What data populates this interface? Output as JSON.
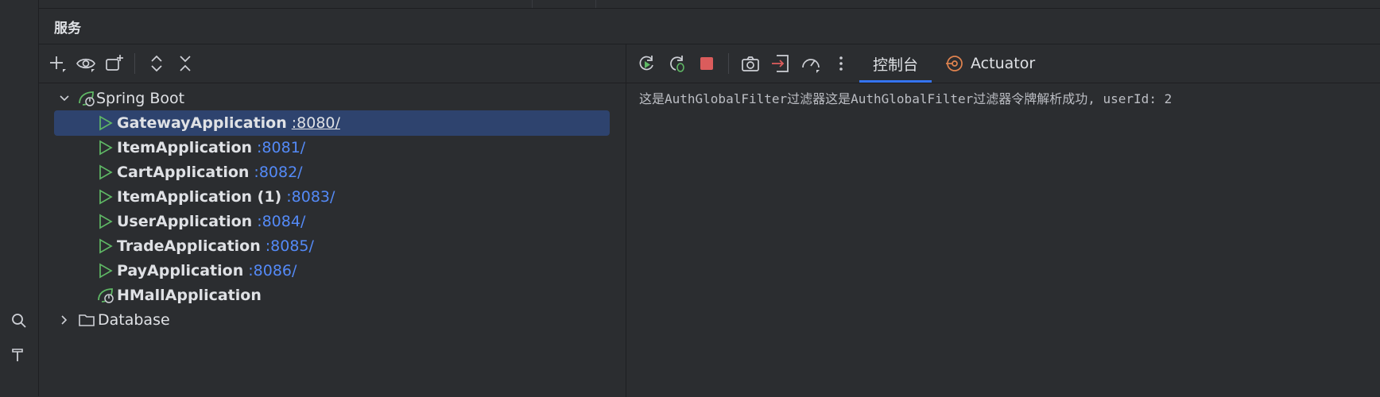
{
  "panel": {
    "title": "服务"
  },
  "tree": {
    "group": {
      "label": "Spring Boot"
    },
    "apps": [
      {
        "name": "GatewayApplication",
        "port": ":8080/"
      },
      {
        "name": "ItemApplication",
        "port": ":8081/"
      },
      {
        "name": "CartApplication",
        "port": ":8082/"
      },
      {
        "name": "ItemApplication (1)",
        "port": ":8083/"
      },
      {
        "name": "UserApplication",
        "port": ":8084/"
      },
      {
        "name": "TradeApplication",
        "port": ":8085/"
      },
      {
        "name": "PayApplication",
        "port": ":8086/"
      }
    ],
    "stopped_app": {
      "name": "HMallApplication"
    },
    "database": {
      "label": "Database"
    }
  },
  "tabs": {
    "console": "控制台",
    "actuator": "Actuator"
  },
  "console": {
    "output": "这是AuthGlobalFilter过滤器这是AuthGlobalFilter过滤器令牌解析成功, userId: 2"
  },
  "colors": {
    "accent": "#3574f0",
    "selection": "#2e436e",
    "link": "#548af7",
    "run_green": "#5fb865",
    "stop_red": "#db5c5c"
  }
}
